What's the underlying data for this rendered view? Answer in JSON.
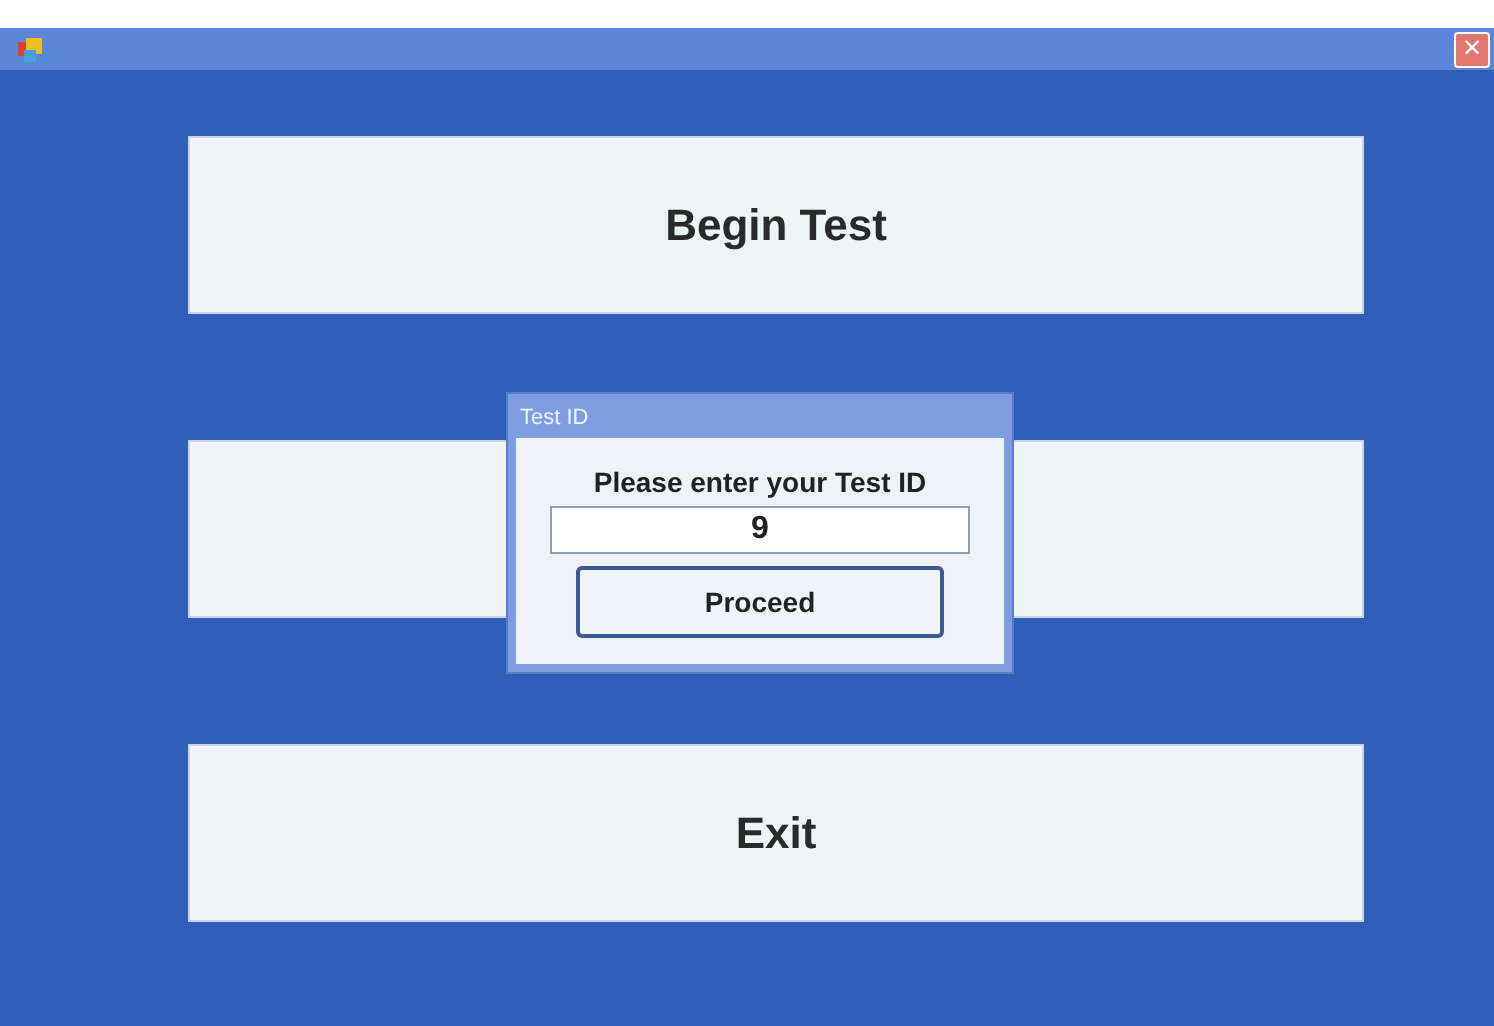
{
  "window": {
    "title_bar": {
      "close": "×"
    }
  },
  "buttons": [
    {
      "kind": "labeled",
      "label": "Begin Test"
    },
    {
      "kind": "covered"
    },
    {
      "kind": "labeled",
      "label": "Exit"
    }
  ],
  "dialog": {
    "title": "Test ID",
    "prompt": "Please enter your Test ID",
    "field": {
      "value": "9"
    },
    "button": "Proceed"
  }
}
